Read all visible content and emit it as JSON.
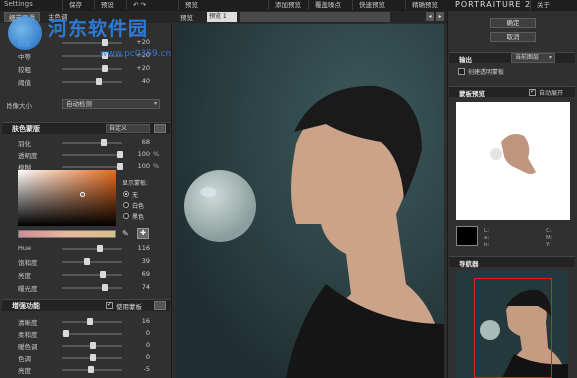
{
  "app": {
    "window_title": "Settings",
    "product_title": "PORTRAITURE 2"
  },
  "topbar": {
    "left_buttons": [
      "保存",
      "预设"
    ],
    "center_buttons": [
      "预览",
      "添加预览",
      "覆盖噪点",
      "快速预览",
      "精确预览"
    ],
    "right_buttons": [
      "关于"
    ]
  },
  "left": {
    "tabs": [
      "细节平滑",
      "主色调"
    ],
    "detail_sliders": [
      {
        "label": "细腻",
        "value": "+20",
        "pos": 0.72
      },
      {
        "label": "中等",
        "value": "+20",
        "pos": 0.72
      },
      {
        "label": "较粗",
        "value": "+20",
        "pos": 0.72
      },
      {
        "label": "阈值",
        "value": "40",
        "pos": 0.6
      }
    ],
    "feature_size_label": "肖像大小",
    "feature_size_value": "自动检测",
    "skin_mask": {
      "title": "肤色蒙版",
      "preset": "自定义",
      "sliders": [
        {
          "label": "羽化",
          "value": "68",
          "unit": "",
          "pos": 0.7
        },
        {
          "label": "透明度",
          "value": "100",
          "unit": "%",
          "pos": 0.98
        },
        {
          "label": "模糊",
          "value": "100",
          "unit": "%",
          "pos": 0.98
        }
      ],
      "display_mask_label": "显示蒙板:",
      "radios": [
        "无",
        "白色",
        "黑色"
      ],
      "radio_selected": 0,
      "hsl_sliders": [
        {
          "label": "Hue",
          "value": "116",
          "pos": 0.62
        },
        {
          "label": "饱和度",
          "value": "39",
          "pos": 0.4
        },
        {
          "label": "亮度",
          "value": "69",
          "pos": 0.68
        },
        {
          "label": "曝光度",
          "value": "74",
          "pos": 0.72
        }
      ]
    },
    "enhancements": {
      "title": "增强功能",
      "use_mask_label": "使用蒙板",
      "use_mask_checked": true,
      "sliders": [
        {
          "label": "清晰度",
          "value": "16",
          "pos": 0.45
        },
        {
          "label": "柔和度",
          "value": "0",
          "pos": 0.02
        },
        {
          "label": "暖色调",
          "value": "0",
          "pos": 0.5
        },
        {
          "label": "色调",
          "value": "0",
          "pos": 0.5
        },
        {
          "label": "亮度",
          "value": "-5",
          "pos": 0.46
        }
      ]
    }
  },
  "viewport": {
    "preview_label": "预览",
    "tab_label": "预览 1"
  },
  "right": {
    "ok_label": "确定",
    "cancel_label": "取消",
    "output": {
      "title": "输出",
      "layer_label": "当前图层",
      "create_transparent_label": "创建透明蒙板",
      "create_transparent_checked": false
    },
    "mask_preview": {
      "title": "蒙板预览",
      "auto_expand_label": "自动展开",
      "auto_expand_checked": true
    },
    "readout": {
      "l": "L:",
      "a": "a:",
      "b": "b:",
      "c": "C:",
      "m": "M:",
      "y": "Y:"
    },
    "navigator_title": "导航器"
  },
  "watermark": {
    "site_name": "河东软件园",
    "url": "www.pc0359.cn"
  },
  "colors": {
    "panel": "#303030",
    "accent_red": "#e02020",
    "watermark_blue": "#2d7fe0"
  }
}
